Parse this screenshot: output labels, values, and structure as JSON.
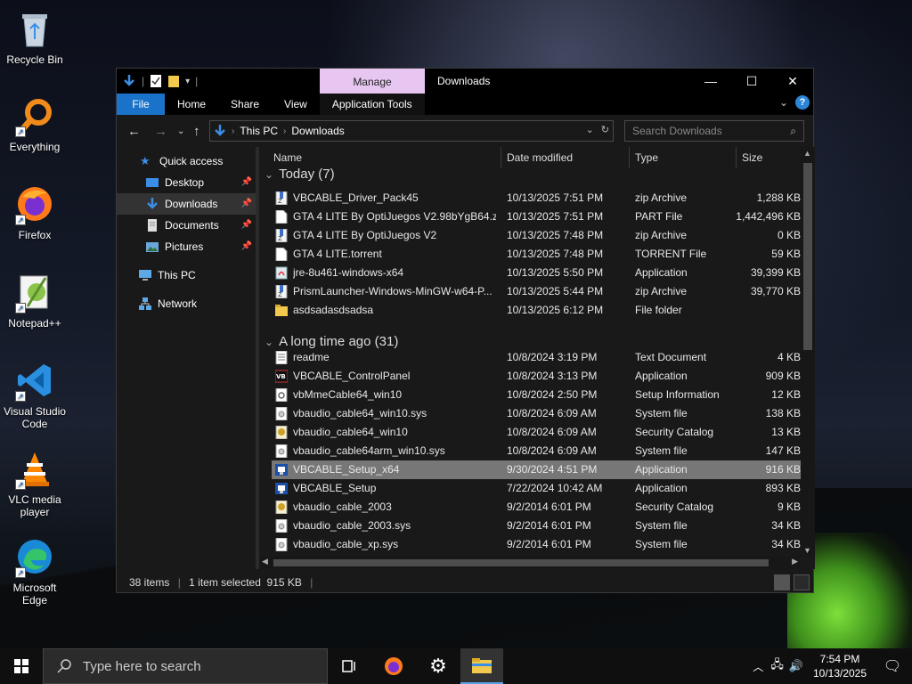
{
  "desktop": {
    "icons": [
      {
        "label": "Recycle Bin",
        "icon": "recycle-bin-icon"
      },
      {
        "label": "Everything",
        "icon": "everything-icon"
      },
      {
        "label": "Firefox",
        "icon": "firefox-icon"
      },
      {
        "label": "Notepad++",
        "icon": "notepad-plus-plus-icon"
      },
      {
        "label": "Visual Studio Code",
        "icon": "vscode-icon"
      },
      {
        "label": "VLC media player",
        "icon": "vlc-icon"
      },
      {
        "label": "Microsoft Edge",
        "icon": "edge-icon"
      }
    ]
  },
  "window": {
    "manage_tab": "Manage",
    "title": "Downloads",
    "ribbon": {
      "file": "File",
      "home": "Home",
      "share": "Share",
      "view": "View",
      "app_tools": "Application Tools"
    },
    "address": {
      "this_pc": "This PC",
      "downloads": "Downloads"
    },
    "search_placeholder": "Search Downloads",
    "nav": {
      "quick_access": "Quick access",
      "desktop": "Desktop",
      "downloads": "Downloads",
      "documents": "Documents",
      "pictures": "Pictures",
      "this_pc": "This PC",
      "network": "Network"
    },
    "columns": {
      "name": "Name",
      "date": "Date modified",
      "type": "Type",
      "size": "Size"
    },
    "groups": [
      {
        "label": "Today (7)",
        "files": [
          {
            "name": "VBCABLE_Driver_Pack45",
            "date": "10/13/2025 7:51 PM",
            "type": "zip Archive",
            "size": "1,288 KB",
            "icon": "zip"
          },
          {
            "name": "GTA 4 LITE By OptiJuegos V2.98bYgB64.zi...",
            "date": "10/13/2025 7:51 PM",
            "type": "PART File",
            "size": "1,442,496 KB",
            "icon": "file"
          },
          {
            "name": "GTA 4 LITE By OptiJuegos V2",
            "date": "10/13/2025 7:48 PM",
            "type": "zip Archive",
            "size": "0 KB",
            "icon": "zip"
          },
          {
            "name": "GTA 4 LITE.torrent",
            "date": "10/13/2025 7:48 PM",
            "type": "TORRENT File",
            "size": "59 KB",
            "icon": "file"
          },
          {
            "name": "jre-8u461-windows-x64",
            "date": "10/13/2025 5:50 PM",
            "type": "Application",
            "size": "39,399 KB",
            "icon": "app"
          },
          {
            "name": "PrismLauncher-Windows-MinGW-w64-P...",
            "date": "10/13/2025 5:44 PM",
            "type": "zip Archive",
            "size": "39,770 KB",
            "icon": "zip"
          },
          {
            "name": "asdsadasdsadsa",
            "date": "10/13/2025 6:12 PM",
            "type": "File folder",
            "size": "",
            "icon": "folder"
          }
        ]
      },
      {
        "label": "A long time ago (31)",
        "files": [
          {
            "name": "readme",
            "date": "10/8/2024 3:19 PM",
            "type": "Text Document",
            "size": "4 KB",
            "icon": "text"
          },
          {
            "name": "VBCABLE_ControlPanel",
            "date": "10/8/2024 3:13 PM",
            "type": "Application",
            "size": "909 KB",
            "icon": "vb"
          },
          {
            "name": "vbMmeCable64_win10",
            "date": "10/8/2024 2:50 PM",
            "type": "Setup Information",
            "size": "12 KB",
            "icon": "setup"
          },
          {
            "name": "vbaudio_cable64_win10.sys",
            "date": "10/8/2024 6:09 AM",
            "type": "System file",
            "size": "138 KB",
            "icon": "sys"
          },
          {
            "name": "vbaudio_cable64_win10",
            "date": "10/8/2024 6:09 AM",
            "type": "Security Catalog",
            "size": "13 KB",
            "icon": "cat"
          },
          {
            "name": "vbaudio_cable64arm_win10.sys",
            "date": "10/8/2024 6:09 AM",
            "type": "System file",
            "size": "147 KB",
            "icon": "sys"
          },
          {
            "name": "VBCABLE_Setup_x64",
            "date": "9/30/2024 4:51 PM",
            "type": "Application",
            "size": "916 KB",
            "icon": "vbsetup",
            "selected": true
          },
          {
            "name": "VBCABLE_Setup",
            "date": "7/22/2024 10:42 AM",
            "type": "Application",
            "size": "893 KB",
            "icon": "vbsetup"
          },
          {
            "name": "vbaudio_cable_2003",
            "date": "9/2/2014 6:01 PM",
            "type": "Security Catalog",
            "size": "9 KB",
            "icon": "cat"
          },
          {
            "name": "vbaudio_cable_2003.sys",
            "date": "9/2/2014 6:01 PM",
            "type": "System file",
            "size": "34 KB",
            "icon": "sys"
          },
          {
            "name": "vbaudio_cable_xp.sys",
            "date": "9/2/2014 6:01 PM",
            "type": "System file",
            "size": "34 KB",
            "icon": "sys"
          }
        ]
      }
    ],
    "status": {
      "items": "38 items",
      "selected": "1 item selected  915 KB"
    }
  },
  "taskbar": {
    "search_placeholder": "Type here to search",
    "time": "7:54 PM",
    "date": "10/13/2025"
  },
  "colors": {
    "accent": "#1a73c9",
    "manage": "#e8c6f2",
    "selected_row": "#777777"
  }
}
